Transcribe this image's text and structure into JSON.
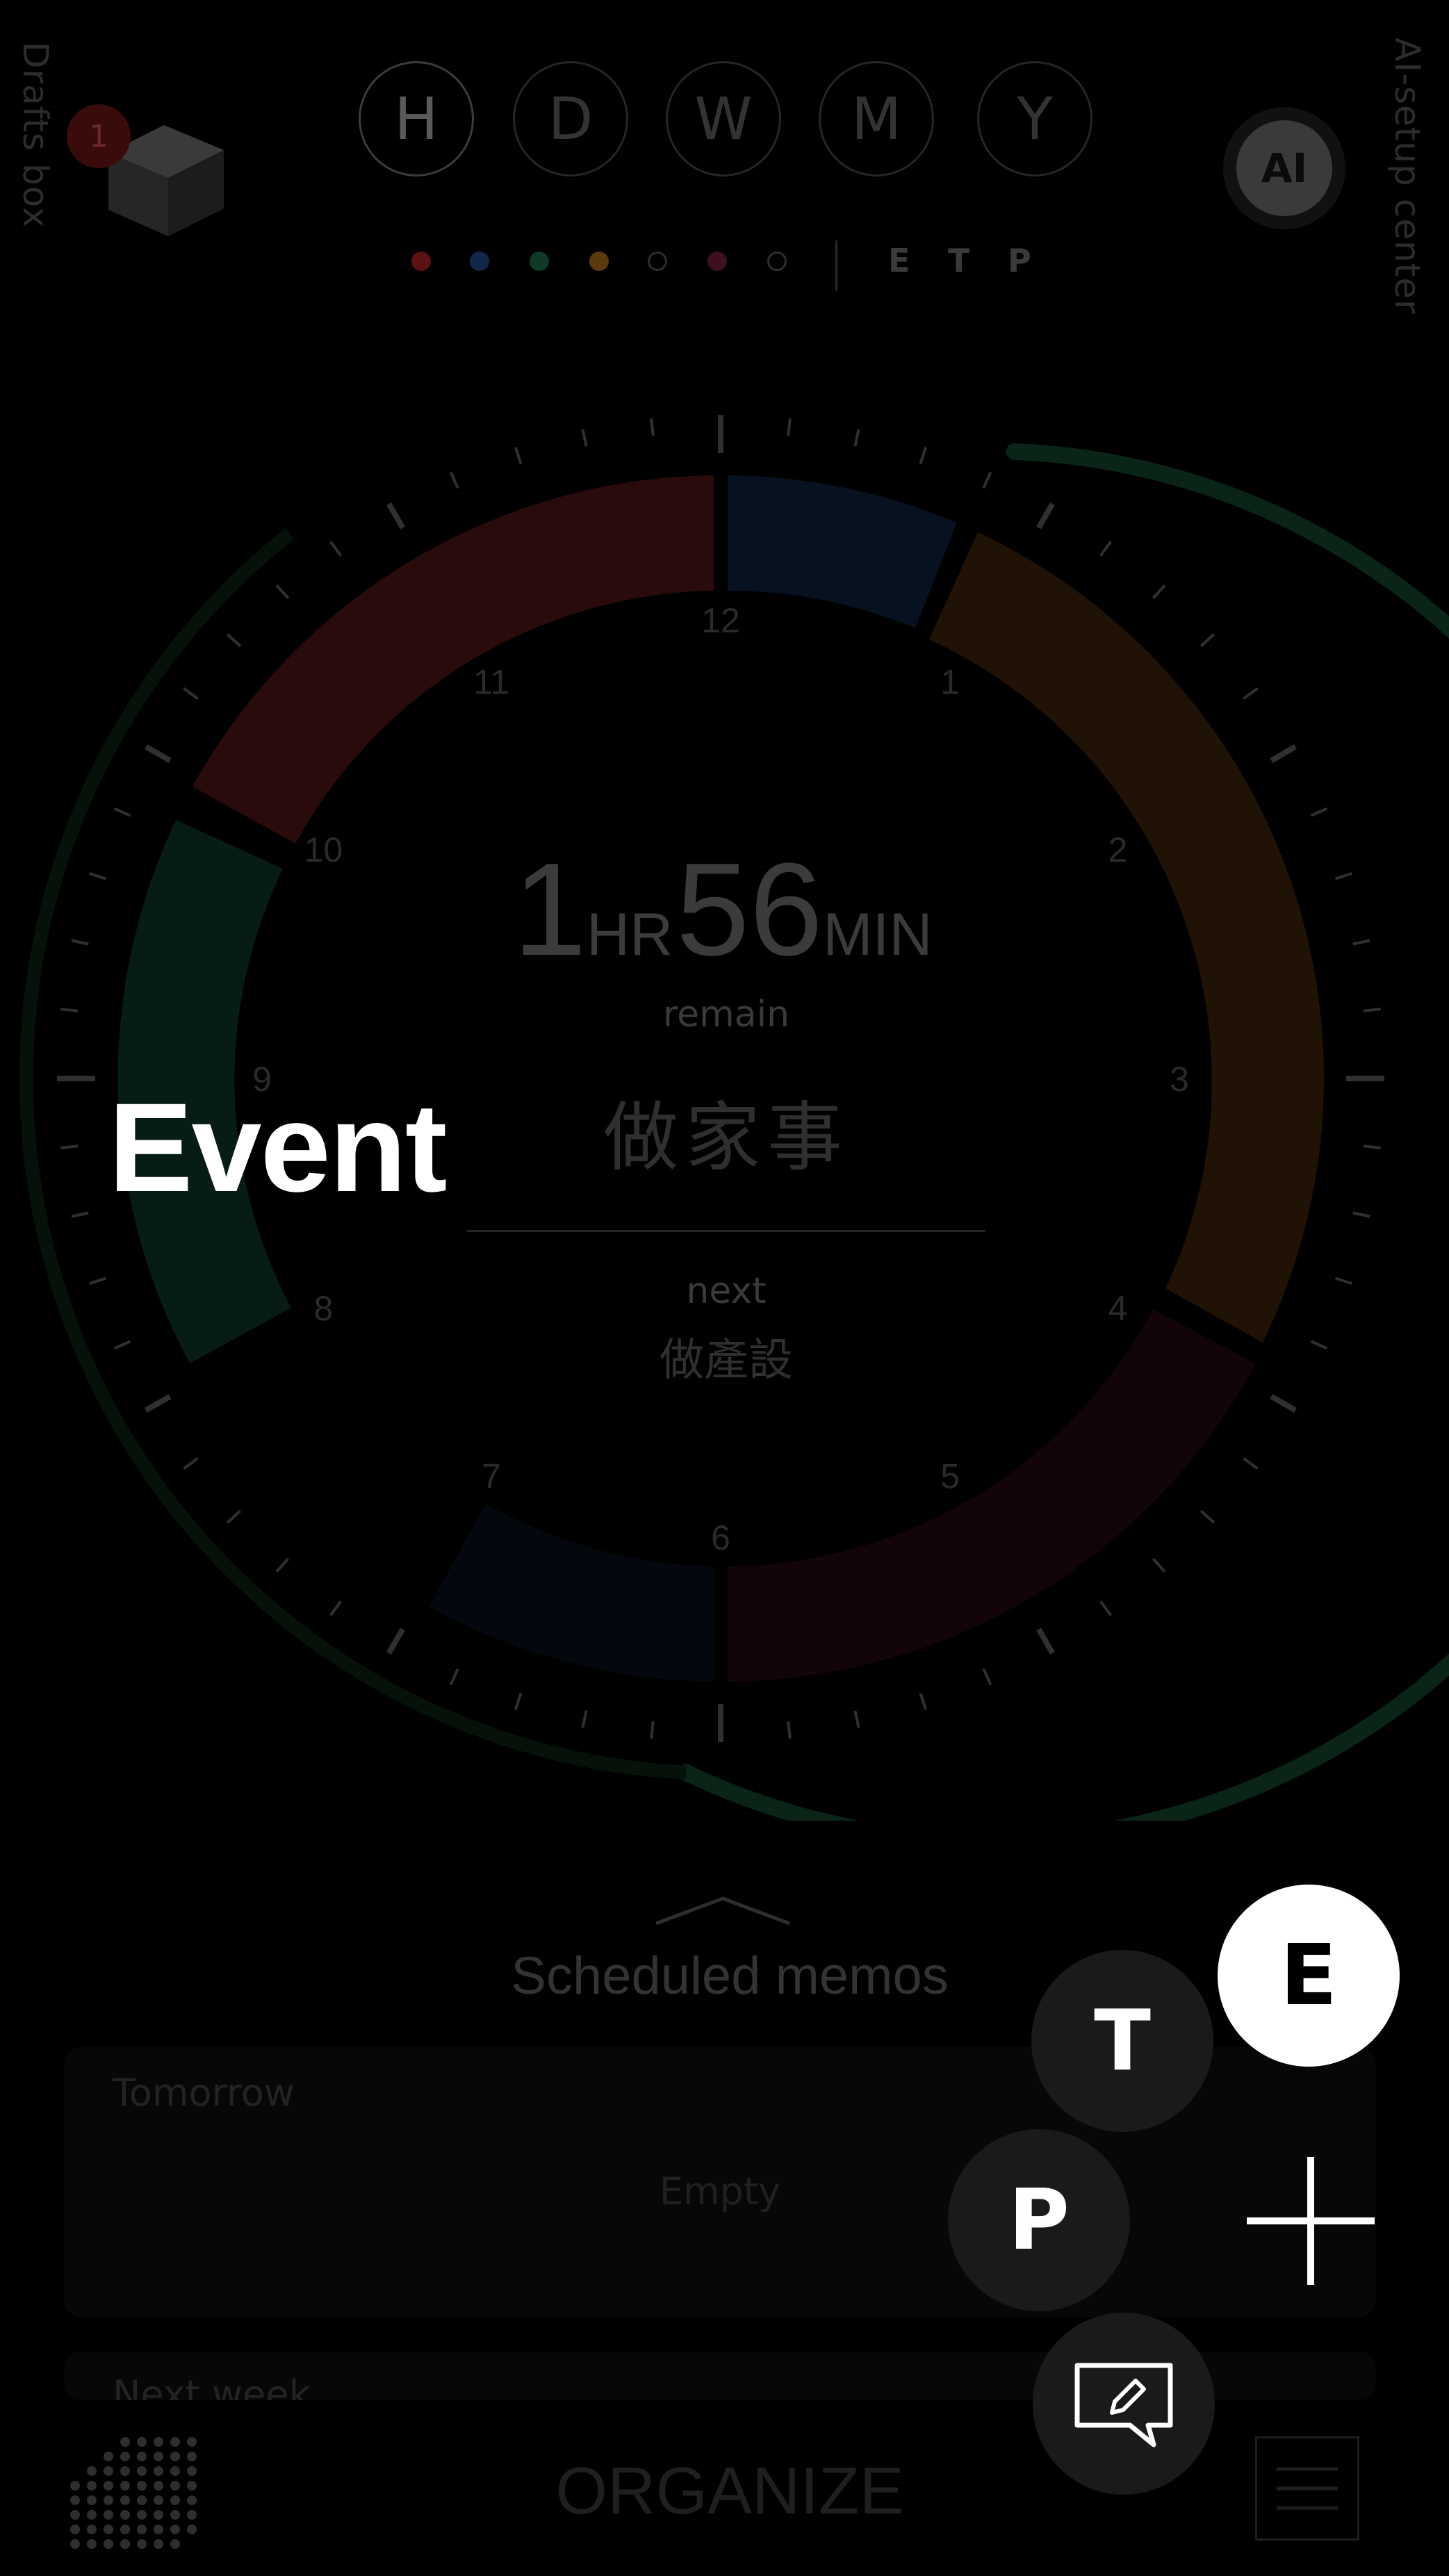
{
  "sidebar_left": {
    "label": "Drafts box",
    "badge_count": "1"
  },
  "sidebar_right": {
    "label": "AI-setup center",
    "ai_button": "AI"
  },
  "period_tabs": [
    {
      "label": "H",
      "active": true
    },
    {
      "label": "D",
      "active": false
    },
    {
      "label": "W",
      "active": false
    },
    {
      "label": "M",
      "active": false
    },
    {
      "label": "Y",
      "active": false
    }
  ],
  "color_filters": [
    "#5c1212",
    "#10284a",
    "#0f3a26",
    "#5a3a0c",
    "none",
    "#3e0f1e",
    "none"
  ],
  "mode_letters": [
    "E",
    "T",
    "P"
  ],
  "clock": {
    "hour_labels": [
      "12",
      "1",
      "2",
      "3",
      "4",
      "5",
      "6",
      "7",
      "8",
      "9",
      "10",
      "11"
    ],
    "remain_hours": "1",
    "hr_unit": "HR",
    "remain_minutes": "56",
    "min_unit": "MIN",
    "remain_label": "remain",
    "current_task": "做家事",
    "next_label": "next",
    "next_task": "做產設"
  },
  "overlay_label": "Event",
  "memos": {
    "title": "Scheduled memos",
    "cards": [
      {
        "heading": "Tomorrow",
        "content": "Empty"
      },
      {
        "heading": "Next week",
        "content": ""
      }
    ]
  },
  "bottom_bar": {
    "title": "ORGANIZE"
  },
  "fab_menu": {
    "event": "E",
    "task": "T",
    "project": "P"
  },
  "colors": {
    "red_segment": "#2a0b0b",
    "blue_segment": "#06121f",
    "orange_segment": "#201205",
    "green_segment": "#071c12",
    "maroon_segment": "#12040a",
    "progress_ring": "#0a2418"
  }
}
